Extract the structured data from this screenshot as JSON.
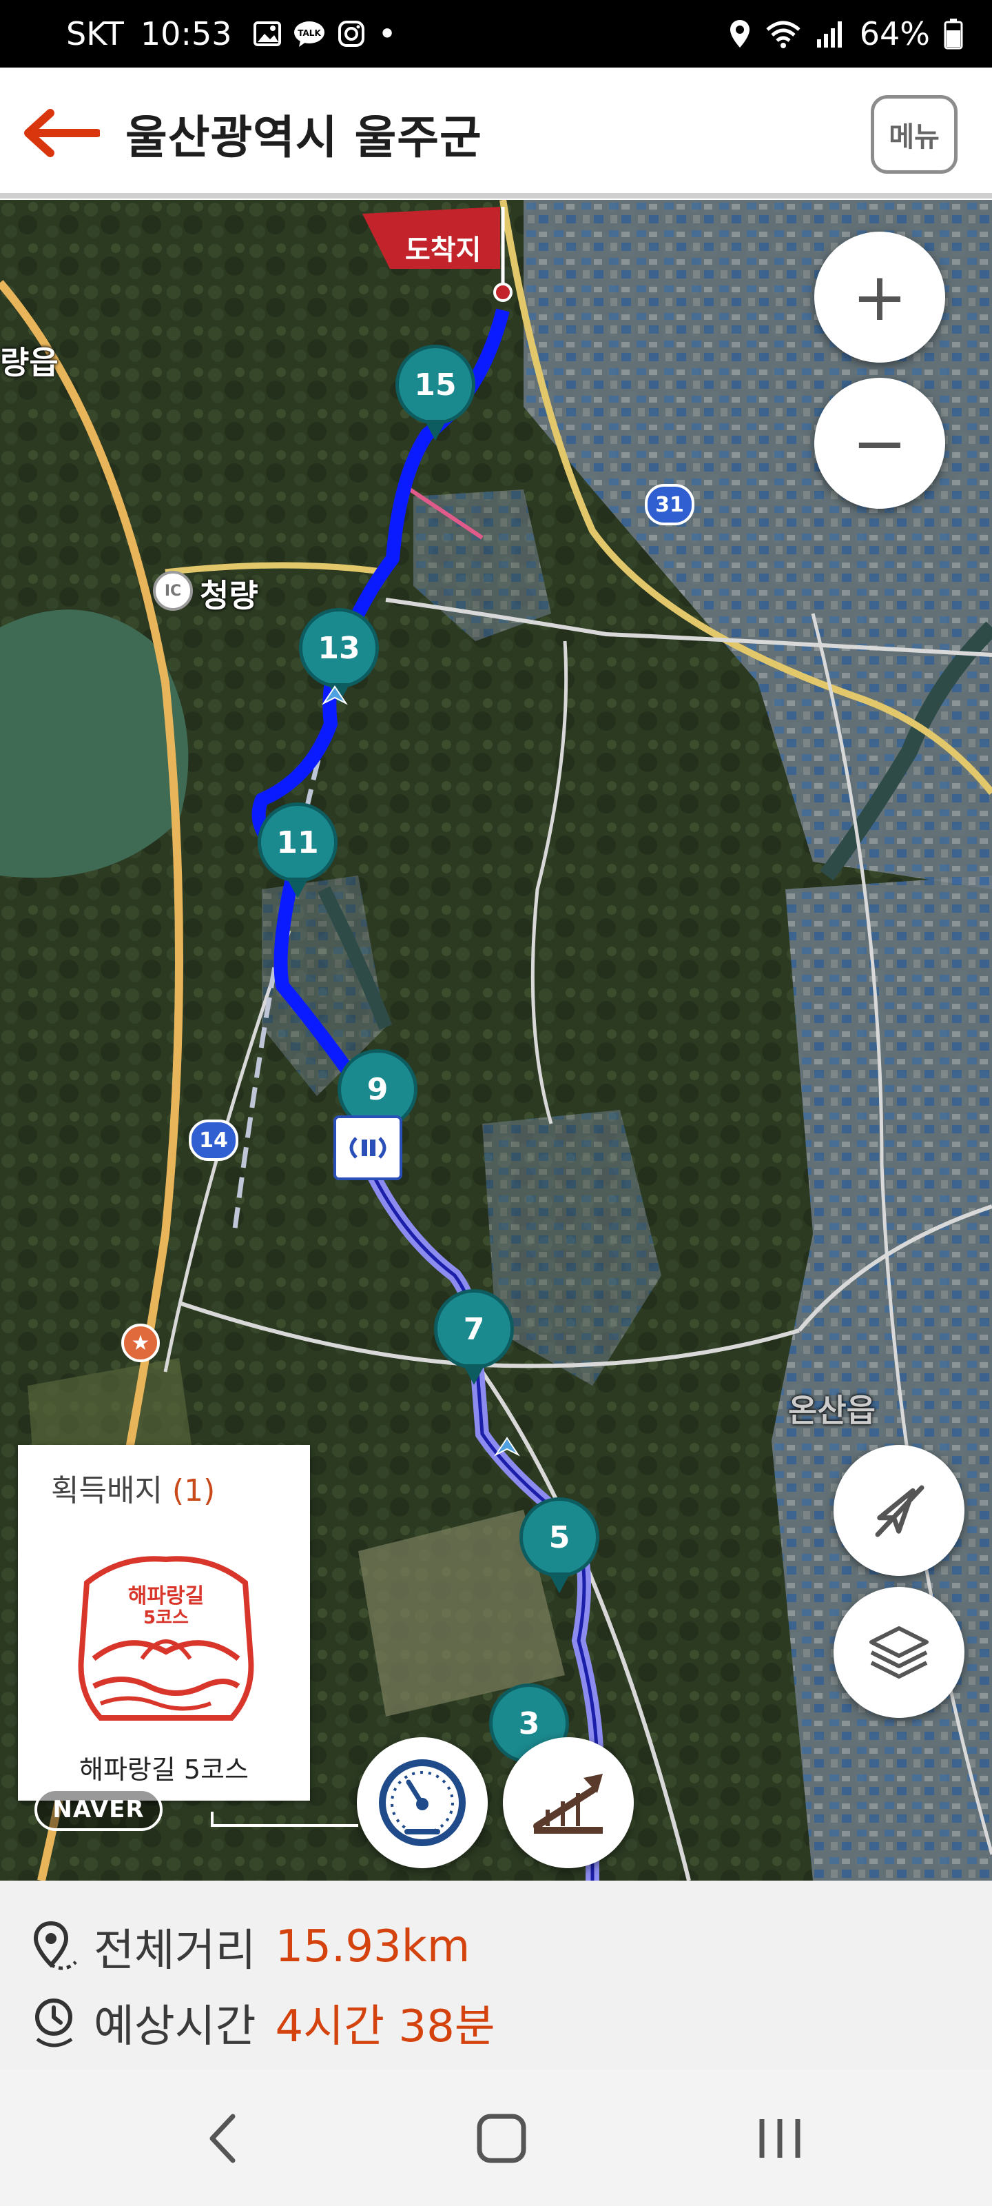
{
  "status_bar": {
    "carrier": "SKT",
    "time": "10:53",
    "dot": "•",
    "battery": "64%"
  },
  "header": {
    "title": "울산광역시 울주군",
    "menu_label": "메뉴"
  },
  "map": {
    "destination_label": "도착지",
    "place_labels": {
      "cheongryang": "청량",
      "ic": "IC",
      "onsan": "온산읍",
      "left_edge": "량읍"
    },
    "route_shields": {
      "r31": "31",
      "r14": "14"
    },
    "markers": [
      "15",
      "13",
      "11",
      "9",
      "7",
      "5",
      "3"
    ],
    "controls": {
      "zoom_in": "+",
      "zoom_out": "−"
    },
    "badge_card": {
      "title": "획득배지",
      "count": "(1)",
      "stamp_text_line1": "해파랑길",
      "stamp_text_line2": "5코스",
      "name": "해파랑길 5코스"
    },
    "watermark": "NAVER"
  },
  "info_panel": {
    "distance_label": "전체거리",
    "distance_value": "15.93km",
    "time_label": "예상시간",
    "time_value": "4시간 38분"
  },
  "colors": {
    "accent": "#d4420d",
    "route_blue": "#0a1cff",
    "route_light": "#8c8cf0",
    "marker": "#1b8a8f",
    "flag": "#c3242b"
  }
}
